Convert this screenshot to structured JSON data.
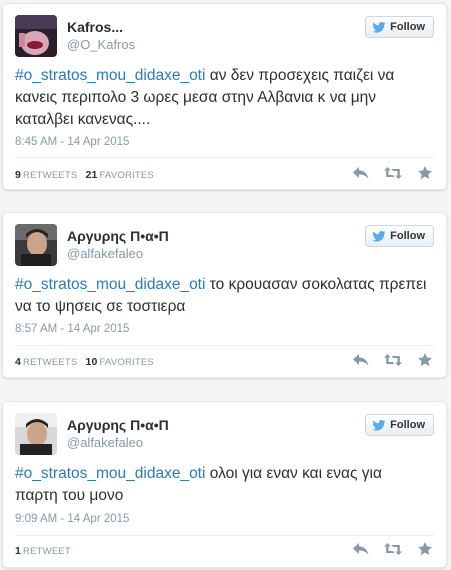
{
  "tweets": [
    {
      "name": "Kafros...",
      "handle": "@O_Kafros",
      "follow_label": "Follow",
      "hashtag": "#o_stratos_mou_didaxe_oti",
      "text": " αν δεν προσεχεις παιζει να κανεις περιπολο 3 ωρες μεσα στην Αλβανια κ να μην καταλβει κανενας....",
      "time": "8:45 AM - 14 Apr 2015",
      "retweets_count": "9",
      "retweets_label": "RETWEETS",
      "favorites_count": "21",
      "favorites_label": "FAVORITES"
    },
    {
      "name": "Αργυρης Π•α•Π",
      "handle": "@alfakefaleo",
      "follow_label": "Follow",
      "hashtag": "#o_stratos_mou_didaxe_oti",
      "text": " το κρουασαν σοκολατας πρεπει να το ψησεις σε τοστιερα",
      "time": "8:57 AM - 14 Apr 2015",
      "retweets_count": "4",
      "retweets_label": "RETWEETS",
      "favorites_count": "10",
      "favorites_label": "FAVORITES"
    },
    {
      "name": "Αργυρης Π•α•Π",
      "handle": "@alfakefaleo",
      "follow_label": "Follow",
      "hashtag": "#o_stratos_mou_didaxe_oti",
      "text": " ολοι για εναν και ενας για παρτη του μονο",
      "time": "9:09 AM - 14 Apr 2015",
      "retweets_count": "1",
      "retweets_label": "RETWEET"
    }
  ],
  "icons": {
    "follow": "twitter-bird-icon",
    "reply": "reply-icon",
    "retweet": "retweet-icon",
    "favorite": "star-icon"
  },
  "colors": {
    "hashtag": "#2b7bb9",
    "muted": "#8899a6",
    "text": "#292f33",
    "bird": "#55acee"
  }
}
